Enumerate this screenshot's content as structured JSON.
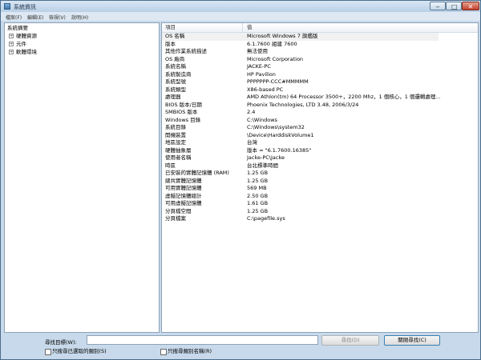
{
  "window": {
    "title": "系統資訊",
    "controls": {
      "minimize": "‒",
      "maximize": "□",
      "close": "✕"
    }
  },
  "menu": [
    "檔案(F)",
    "編輯(E)",
    "檢視(V)",
    "說明(H)"
  ],
  "tree": [
    {
      "label": "系統摘要",
      "expander": ""
    },
    {
      "label": "硬體資源",
      "expander": "+"
    },
    {
      "label": "元件",
      "expander": "+"
    },
    {
      "label": "軟體環境",
      "expander": "+"
    }
  ],
  "table": {
    "headers": [
      "項目",
      "值"
    ],
    "rows": [
      [
        "OS 名稱",
        "Microsoft Windows 7 旗艦版"
      ],
      [
        "版本",
        "6.1.7600 組建 7600"
      ],
      [
        "其他作業系統描述",
        "無法使用"
      ],
      [
        "OS 廠商",
        "Microsoft Corporation"
      ],
      [
        "系統名稱",
        "JACKE-PC"
      ],
      [
        "系統製造商",
        "HP Pavilion"
      ],
      [
        "系統型號",
        "PPPPPPP-CCC#MMMMM"
      ],
      [
        "系統類型",
        "X86-based PC"
      ],
      [
        "處理器",
        "AMD Athlon(tm) 64 Processor 3500+，2200 Mhz，1 個核心，1 個邏輯處理..."
      ],
      [
        "BIOS 版本/日期",
        "Phoenix Technologies, LTD 3.48, 2006/3/24"
      ],
      [
        "SMBIOS 版本",
        "2.4"
      ],
      [
        "Windows 目錄",
        "C:\\Windows"
      ],
      [
        "系統目錄",
        "C:\\Windows\\system32"
      ],
      [
        "開機裝置",
        "\\Device\\HarddiskVolume1"
      ],
      [
        "地區設定",
        "台灣"
      ],
      [
        "硬體抽象層",
        "版本 = \"6.1.7600.16385\""
      ],
      [
        "使用者名稱",
        "Jacke-PC\\Jacke"
      ],
      [
        "時區",
        "台北標準時間"
      ],
      [
        "已安裝的實體記憶體 (RAM)",
        "1.25 GB"
      ],
      [
        "總共實體記憶體",
        "1.25 GB"
      ],
      [
        "可用實體記憶體",
        "569 MB"
      ],
      [
        "虛擬記憶體總計",
        "2.50 GB"
      ],
      [
        "可用虛擬記憶體",
        "1.61 GB"
      ],
      [
        "分頁檔空間",
        "1.25 GB"
      ],
      [
        "分頁檔案",
        "C:\\pagefile.sys"
      ]
    ]
  },
  "bottom": {
    "search_label": "尋找目標(W):",
    "search_value": "",
    "find_button": "尋找(D)",
    "close_find_button": "關閉尋找(C)",
    "checkbox_selected_category": "只搜尋已選取的類別(S)",
    "checkbox_category_names": "只搜尋類別名稱(R)"
  },
  "colors": {
    "accent": "#3c7fb1",
    "frame": "#c7d9ea"
  }
}
